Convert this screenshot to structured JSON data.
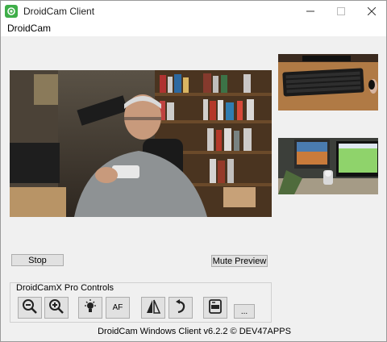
{
  "window": {
    "title": "DroidCam Client"
  },
  "menu": {
    "label": "DroidCam"
  },
  "buttons": {
    "stop": "Stop",
    "mute_preview": "Mute Preview"
  },
  "pro_controls": {
    "title": "DroidCamX Pro Controls",
    "af_label": "AF",
    "more_label": "..."
  },
  "icons": [
    "zoom-out-icon",
    "zoom-in-icon",
    "light-bulb-icon",
    "af-icon",
    "flip-icon",
    "rotate-icon",
    "screenshot-icon"
  ],
  "footer": "DroidCam Windows Client v6.2.2 © DEV47APPS",
  "colors": {
    "accent_green": "#3fae49"
  }
}
